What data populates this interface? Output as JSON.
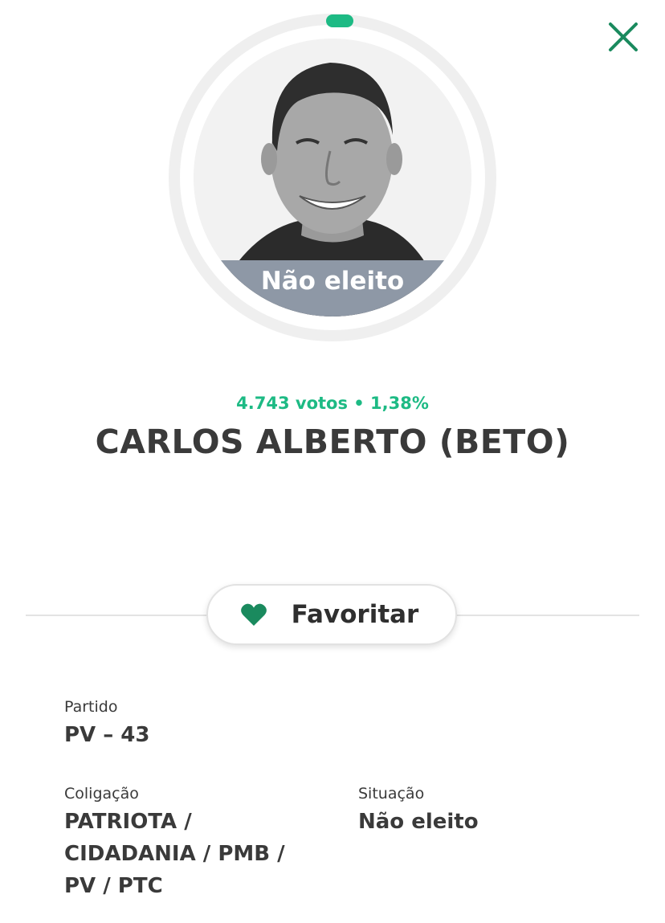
{
  "status_badge": "Não eleito",
  "votes_line": "4.743 votos • 1,38%",
  "candidate_name": "CARLOS ALBERTO (BETO)",
  "favorite_label": "Favoritar",
  "partido": {
    "label": "Partido",
    "value": "PV – 43"
  },
  "coligacao": {
    "label": "Coligação",
    "lines": [
      "PATRIOTA /",
      "CIDADANIA / PMB /",
      "PV / PTC"
    ]
  },
  "situacao": {
    "label": "Situação",
    "value": "Não eleito"
  },
  "icons": {
    "close": "close-icon",
    "favorite": "heart-icon"
  },
  "colors": {
    "accent": "#1dba84",
    "status_overlay": "#8e98a6"
  }
}
